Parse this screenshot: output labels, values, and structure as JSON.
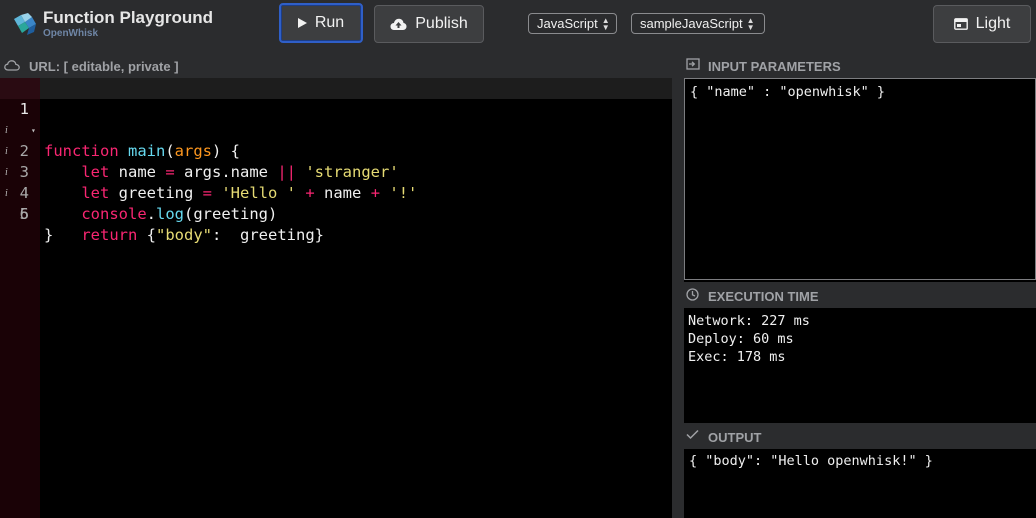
{
  "header": {
    "title": "Function Playground",
    "subtitle": "OpenWhisk",
    "run_label": "Run",
    "publish_label": "Publish",
    "theme_label": "Light",
    "language_select": "JavaScript",
    "sample_select": "sampleJavaScript",
    "icons": {
      "logo": "openwhisk-logo",
      "run": "play-icon",
      "publish": "cloud-upload-icon",
      "theme": "window-icon"
    }
  },
  "url_bar": {
    "text": "URL: [ editable, private ]",
    "icon": "cloud-icon"
  },
  "editor": {
    "line_numbers": [
      "1",
      "2",
      "3",
      "4",
      "5",
      "6"
    ],
    "info_marker": "i",
    "lines": [
      {
        "t1": "function",
        "t2": " ",
        "t3": "main",
        "t4": "(",
        "t5": "args",
        "t6": ") {"
      },
      {
        "indent": "    ",
        "kw": "let",
        "a": " name ",
        "op1": "=",
        "b": " args.name ",
        "op2": "||",
        "c": " ",
        "str": "'stranger'"
      },
      {
        "indent": "    ",
        "kw": "let",
        "a": " greeting ",
        "op1": "=",
        "b": " ",
        "str1": "'Hello '",
        "c": " ",
        "op2": "+",
        "d": " name ",
        "op3": "+",
        "e": " ",
        "str2": "'!'"
      },
      {
        "indent": "    ",
        "obj": "console",
        "dot": ".",
        "fn": "log",
        "rest": "(greeting)"
      },
      {
        "indent": "    ",
        "kw": "return",
        "a": " {",
        "str": "\"body\"",
        "b": ":  greeting}"
      },
      {
        "text": "}"
      }
    ]
  },
  "panels": {
    "input": {
      "title": "INPUT PARAMETERS",
      "value": "{ \"name\" : \"openwhisk\" }",
      "icon": "login-icon"
    },
    "execution": {
      "title": "EXECUTION TIME",
      "lines": [
        "Network: 227 ms",
        "Deploy: 60 ms",
        "Exec: 178 ms"
      ],
      "icon": "clock-icon"
    },
    "output": {
      "title": "OUTPUT",
      "value": "{ \"body\": \"Hello openwhisk!\" }",
      "icon": "check-icon"
    }
  }
}
